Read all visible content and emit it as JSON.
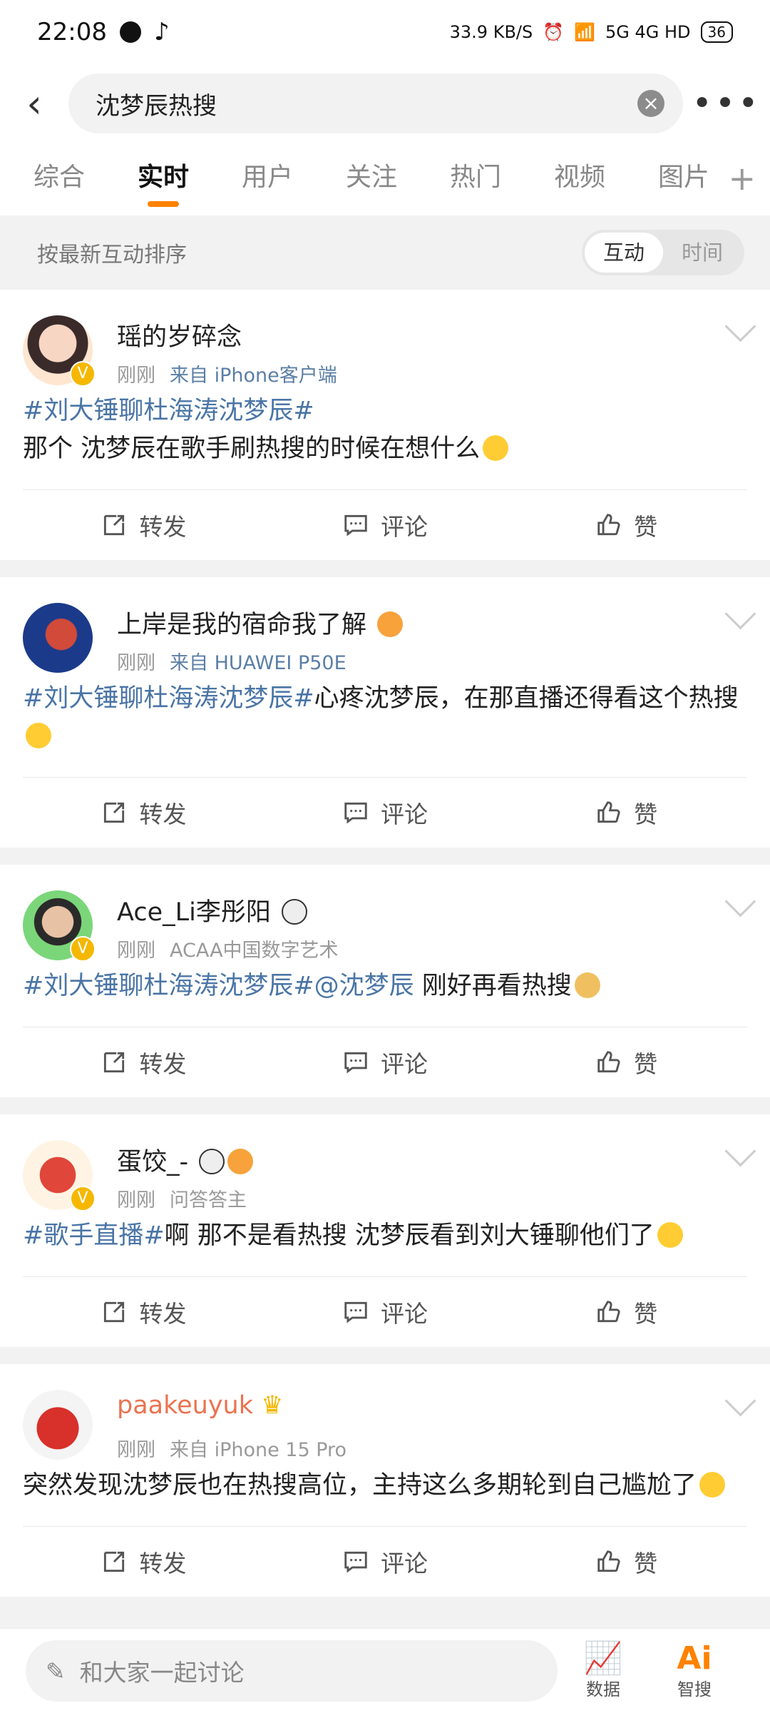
{
  "status": {
    "time": "22:08",
    "speed": "33.9 KB/S",
    "network": "5G 4G HD",
    "battery": "36"
  },
  "search": {
    "query": "沈梦辰热搜"
  },
  "tabs": [
    "综合",
    "实时",
    "用户",
    "关注",
    "热门",
    "视频",
    "图片"
  ],
  "active_tab": "实时",
  "sort": {
    "label": "按最新互动排序",
    "opt1": "互动",
    "opt2": "时间"
  },
  "actions": {
    "repost": "转发",
    "comment": "评论",
    "like": "赞"
  },
  "posts": [
    {
      "name": "瑶的岁碎念",
      "time": "刚刚",
      "source": "来自 iPhone客户端",
      "tag": "#刘大锤聊杜海涛沈梦辰#",
      "text": "那个 沈梦辰在歌手刷热搜的时候在想什么"
    },
    {
      "name": "上岸是我的宿命我了解",
      "time": "刚刚",
      "source": "来自 HUAWEI P50E",
      "tag": "#刘大锤聊杜海涛沈梦辰#",
      "text": "心疼沈梦辰，在那直播还得看这个热搜"
    },
    {
      "name": "Ace_Li李彤阳",
      "time": "刚刚",
      "source": "ACAA中国数字艺术",
      "tag": "#刘大锤聊杜海涛沈梦辰#",
      "mention": "@沈梦辰",
      "text": " 刚好再看热搜"
    },
    {
      "name": "蛋饺_-",
      "time": "刚刚",
      "source": "问答答主",
      "tag": "#歌手直播#",
      "text": "啊 那不是看热搜 沈梦辰看到刘大锤聊他们了"
    },
    {
      "name": "paakeuyuk",
      "time": "刚刚",
      "source": "来自 iPhone 15 Pro",
      "text": "突然发现沈梦辰也在热搜高位，主持这么多期轮到自己尴尬了"
    }
  ],
  "bottom": {
    "placeholder": "和大家一起讨论",
    "data_label": "数据",
    "ai_label": "智搜"
  },
  "colors": {
    "accent": "#ff8200",
    "link": "#4a75a6",
    "vip": "#eb7350"
  }
}
